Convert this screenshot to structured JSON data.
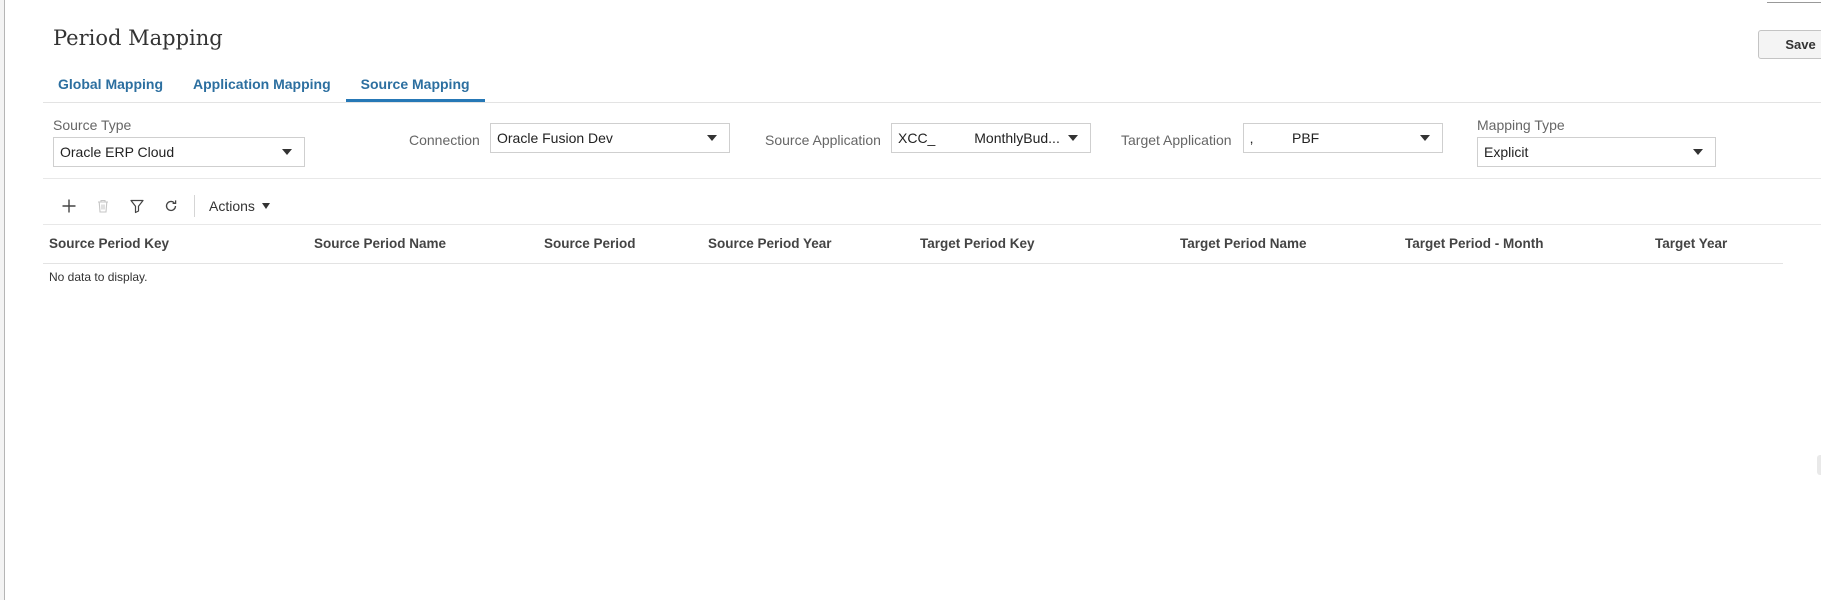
{
  "page": {
    "title": "Period Mapping",
    "save_label": "Save"
  },
  "tabs": [
    {
      "label": "Global Mapping",
      "active": false
    },
    {
      "label": "Application Mapping",
      "active": false
    },
    {
      "label": "Source Mapping",
      "active": true
    }
  ],
  "filters": {
    "source_type": {
      "label": "Source Type",
      "value": "Oracle ERP Cloud"
    },
    "connection": {
      "label": "Connection",
      "value": "Oracle Fusion Dev"
    },
    "source_application": {
      "label": "Source Application",
      "value": "XCC_          MonthlyBud..."
    },
    "target_application": {
      "label": "Target Application",
      "value": "‚          PBF"
    },
    "mapping_type": {
      "label": "Mapping Type",
      "value": "Explicit"
    }
  },
  "toolbar": {
    "icons": [
      "add-icon",
      "delete-icon",
      "filter-icon",
      "refresh-icon"
    ],
    "actions_label": "Actions"
  },
  "table": {
    "columns": [
      "Source Period Key",
      "Source Period Name",
      "Source Period",
      "Source Period Year",
      "Target Period Key",
      "Target Period Name",
      "Target Period - Month",
      "Target Year"
    ],
    "rows": [],
    "empty_message": "No data to display."
  },
  "colors": {
    "tab_text": "#2c6fa0",
    "tab_underline": "#2678b6",
    "text": "#333333"
  }
}
